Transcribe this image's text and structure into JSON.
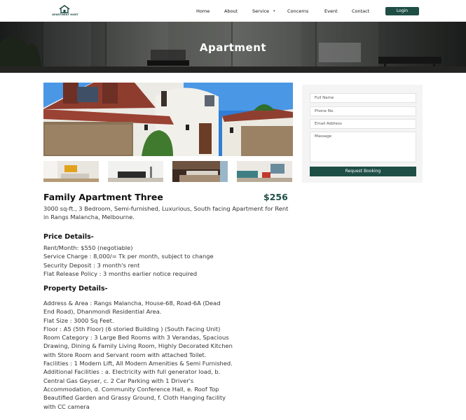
{
  "brand": {
    "name": "APARTMENT HUNT",
    "accent": "#1f4e46"
  },
  "nav": {
    "links": [
      "Home",
      "About",
      "Service",
      "Concerns",
      "Event",
      "Contact"
    ],
    "service_has_dropdown": true,
    "login_label": "Login"
  },
  "hero": {
    "title": "Apartment"
  },
  "listing": {
    "title": "Family Apartment Three",
    "price": "$256",
    "summary": "3000 sq-ft., 3 Bedroom, Semi-furnished, Luxurious, South facing Apartment for Rent in Rangs Malancha, Melbourne.",
    "price_details": {
      "heading": "Price Details-",
      "lines": [
        "Rent/Month: $550 (negotiable)",
        "Service Charge : 8,000/= Tk per month, subject to change",
        "Security Deposit : 3 month's rent",
        "Flat Release Policy : 3 months earlier notice required"
      ]
    },
    "property_details": {
      "heading": "Property Details-",
      "lines": [
        "Address & Area : Rangs Malancha, House-68, Road-6A (Dead",
        "End Road), Dhanmondi Residential Area.",
        "Flat Size : 3000 Sq Feet.",
        "Floor :  A5 (5th Floor) (6 storied Building ) (South Facing Unit)",
        "Room Category : 3 Large Bed Rooms with 3 Verandas, Spacious",
        "Drawing, Dining & Family Living Room, Highly Decorated Kitchen",
        "with Store Room and Servant room with attached Toilet.",
        "Facilities : 1 Modern Lift, All Modern Amenities & Semi Furnished.",
        "Additional Facilities : a. Electricity with full generator load, b.",
        "Central Gas Geyser, c. 2 Car Parking with 1 Driver's",
        "Accommodation, d. Community Conference Hall, e. Roof Top",
        "Beautified Garden and Grassy Ground, f. Cloth Hanging facility",
        "with CC camera"
      ]
    }
  },
  "booking_form": {
    "full_name_placeholder": "Full Name",
    "phone_placeholder": "Phone No.",
    "email_placeholder": "Email Address",
    "message_placeholder": "Massage",
    "submit_label": "Request Booking"
  }
}
